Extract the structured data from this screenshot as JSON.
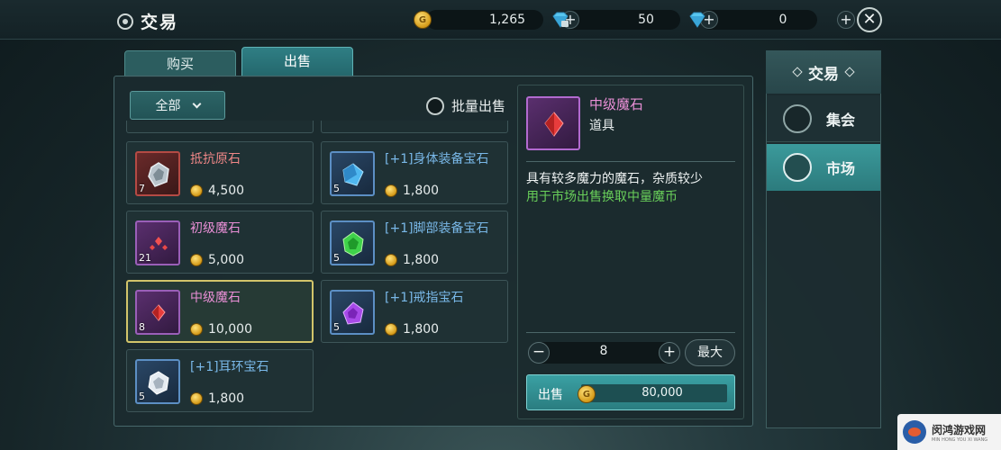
{
  "header": {
    "title": "交易",
    "currencies": [
      {
        "icon": "gold-coin-icon",
        "value": "1,265"
      },
      {
        "icon": "bound-diamond-icon",
        "value": "50"
      },
      {
        "icon": "diamond-icon",
        "value": "0"
      }
    ]
  },
  "tabs": [
    {
      "label": "购买",
      "active": false
    },
    {
      "label": "出售",
      "active": true
    }
  ],
  "filter": {
    "dropdown": "全部",
    "batch_sell": "批量出售"
  },
  "items": [
    {
      "name": "抵抗原石",
      "count": "7",
      "price": "4,500",
      "frame": "red",
      "name_color": "red"
    },
    {
      "name": "[+1]身体装备宝石",
      "count": "5",
      "price": "1,800",
      "frame": "blue",
      "name_color": "blue"
    },
    {
      "name": "初级魔石",
      "count": "21",
      "price": "5,000",
      "frame": "purple",
      "name_color": "pink"
    },
    {
      "name": "[+1]脚部装备宝石",
      "count": "5",
      "price": "1,800",
      "frame": "blue",
      "name_color": "blue"
    },
    {
      "name": "中级魔石",
      "count": "8",
      "price": "10,000",
      "frame": "purple",
      "name_color": "pink",
      "selected": true
    },
    {
      "name": "[+1]戒指宝石",
      "count": "5",
      "price": "1,800",
      "frame": "blue",
      "name_color": "blue"
    },
    {
      "name": "[+1]耳环宝石",
      "count": "5",
      "price": "1,800",
      "frame": "blue",
      "name_color": "blue"
    }
  ],
  "detail": {
    "name": "中级魔石",
    "type": "道具",
    "desc_line1": "具有较多魔力的魔石，杂质较少",
    "desc_line2": "用于市场出售换取中量魔币",
    "quantity": "8",
    "max_label": "最大",
    "sell_label": "出售",
    "sell_total": "80,000"
  },
  "side": {
    "title": "交易",
    "items": [
      {
        "label": "集会",
        "icon": "bag-icon",
        "active": false
      },
      {
        "label": "市场",
        "icon": "stall-icon",
        "active": true
      }
    ]
  },
  "watermark": {
    "text": "闵鸿游戏网",
    "sub": "MIN HONG YOU XI WANG"
  },
  "colors": {
    "accent": "#2c7b7d",
    "pink_name": "#e98fd6",
    "blue_name": "#79b8e8",
    "red_name": "#ef8787",
    "green_desc": "#69cf5a",
    "selected_border": "#d2c46a"
  }
}
